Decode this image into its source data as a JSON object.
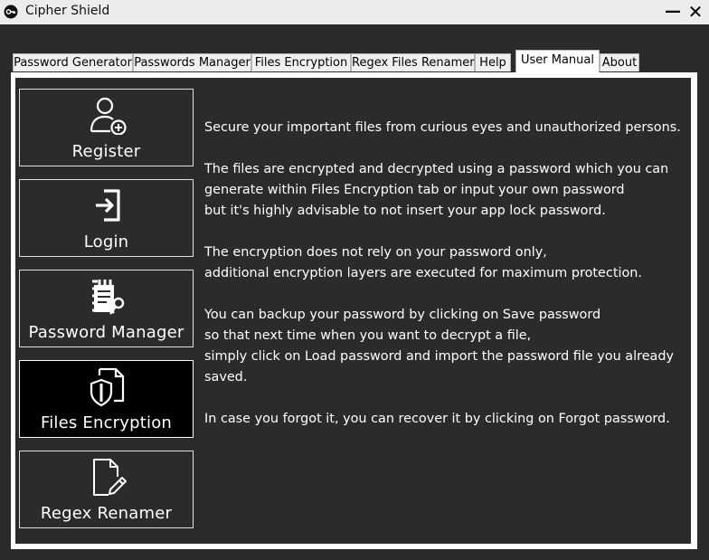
{
  "window": {
    "title": "Cipher Shield",
    "minimize_label": "—",
    "close_label": "✕"
  },
  "tabs": [
    {
      "label": "Password Generator"
    },
    {
      "label": "Passwords Manager"
    },
    {
      "label": "Files Encryption"
    },
    {
      "label": "Regex Files Renamer"
    },
    {
      "label": "Help"
    },
    {
      "label": "User Manual"
    },
    {
      "label": "About"
    }
  ],
  "active_tab": "User Manual",
  "sidebar": {
    "items": [
      {
        "label": "Register",
        "icon": "user-add-icon"
      },
      {
        "label": "Login",
        "icon": "login-icon"
      },
      {
        "label": "Password Manager",
        "icon": "password-manager-icon"
      },
      {
        "label": "Files Encryption",
        "icon": "file-shield-icon"
      },
      {
        "label": "Regex Renamer",
        "icon": "file-edit-icon"
      }
    ],
    "active_item": "Files Encryption"
  },
  "manual": {
    "paragraphs": [
      "Secure your important files from curious eyes and unauthorized persons.",
      "The files are encrypted and decrypted using a password which you can\ngenerate within Files Encryption tab or input your own password\nbut it's highly advisable to not insert your app lock password.",
      "The encryption does not rely on your password only,\nadditional encryption layers are executed for maximum protection.",
      "You can backup your password by clicking on Save password\nso that next time when you want to decrypt a file,\nsimply click on Load password and import the password file you already\nsaved.",
      "In case you forgot it, you can recover it by clicking on Forgot password."
    ]
  },
  "colors": {
    "background": "#2b2b2b",
    "text": "#ffffff",
    "active_button": "#000000",
    "titlebar": "#ececec"
  }
}
